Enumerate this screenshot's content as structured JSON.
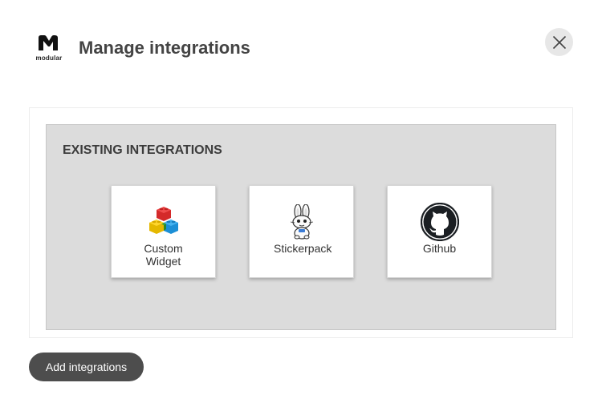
{
  "header": {
    "logo_text": "modular",
    "title": "Manage integrations"
  },
  "section": {
    "heading": "EXISTING INTEGRATIONS"
  },
  "integrations": [
    {
      "label": "Custom Widget",
      "icon": "lego-blocks-icon"
    },
    {
      "label": "Stickerpack",
      "icon": "bunny-sticker-icon"
    },
    {
      "label": "Github",
      "icon": "github-octocat-icon"
    }
  ],
  "footer": {
    "add_label": "Add integrations"
  },
  "colors": {
    "button_bg": "#4d4d4d",
    "panel_bg": "#dcdcdc",
    "close_bg": "#e7e7e7"
  }
}
